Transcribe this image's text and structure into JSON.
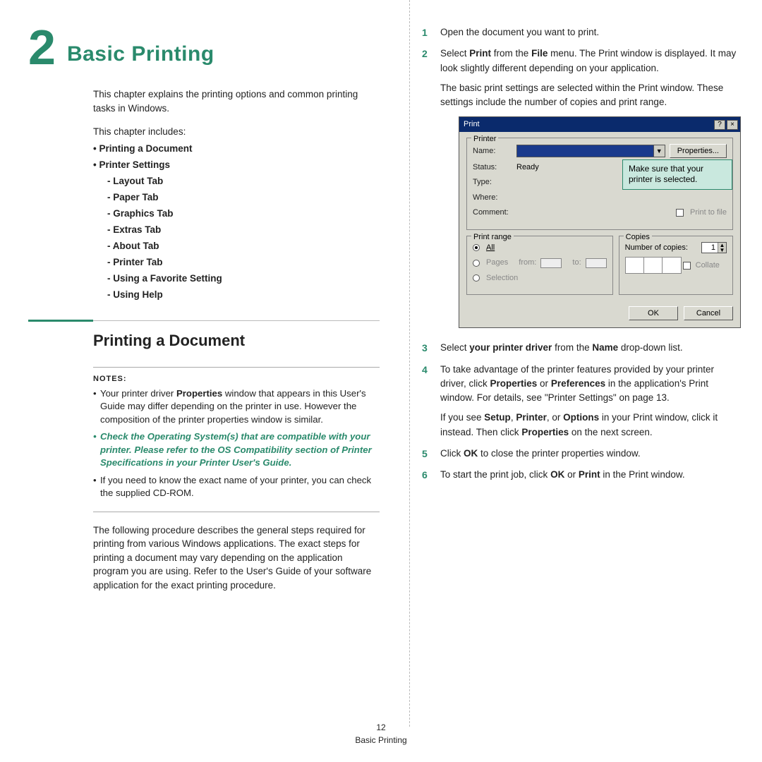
{
  "chapter": {
    "number": "2",
    "title": "Basic Printing"
  },
  "intro": "This chapter explains the printing options and common printing tasks in Windows.",
  "includes_label": "This chapter includes:",
  "toc": {
    "i0": "Printing a Document",
    "i1": "Printer Settings",
    "s0": "Layout Tab",
    "s1": "Paper Tab",
    "s2": "Graphics Tab",
    "s3": "Extras Tab",
    "s4": "About Tab",
    "s5": "Printer Tab",
    "s6": "Using a Favorite Setting",
    "s7": "Using Help"
  },
  "section1_title": "Printing a Document",
  "notes": {
    "label": "NOTES:",
    "n0a": "Your printer driver ",
    "n0b": "Properties",
    "n0c": " window that appears in this User's Guide may differ depending on the printer in use. However the composition of the printer properties window is similar.",
    "n1": "Check the Operating System(s) that are compatible with your printer. Please refer to the OS Compatibility section of Printer Specifications in your Printer User's Guide.",
    "n2": "If you need to know the exact name of your printer, you can check the supplied CD-ROM."
  },
  "after_notes": "The following procedure describes the general steps required for printing from various Windows applications. The exact steps for printing a document may vary depending on the application program you are using. Refer to the User's Guide of your software application for the exact printing procedure.",
  "steps": {
    "s1": "Open the document you want to print.",
    "s2a": "Select ",
    "s2b": "Print",
    "s2c": " from the ",
    "s2d": "File",
    "s2e": " menu. The Print window is displayed. It may look slightly different depending on your application.",
    "s2f": "The basic print settings are selected within the Print window. These settings include the number of copies and print range.",
    "s3a": "Select ",
    "s3b": "your printer driver",
    "s3c": " from the ",
    "s3d": "Name",
    "s3e": " drop-down list.",
    "s4a": "To take advantage of the printer features provided by your printer driver, click ",
    "s4b": "Properties",
    "s4c": " or ",
    "s4d": "Preferences",
    "s4e": " in the application's Print window. For details, see \"Printer Settings\" on page 13.",
    "s4f": "If you see ",
    "s4g": "Setup",
    "s4h": ", ",
    "s4i": "Printer",
    "s4j": ", or ",
    "s4k": "Options",
    "s4l": " in your Print window, click it instead. Then click ",
    "s4m": "Properties",
    "s4n": " on the next screen.",
    "s5a": "Click ",
    "s5b": "OK",
    "s5c": " to close the printer properties window.",
    "s6a": "To start the print job, click ",
    "s6b": "OK",
    "s6c": " or ",
    "s6d": "Print",
    "s6e": " in the Print window."
  },
  "dlg": {
    "title": "Print",
    "help": "?",
    "close": "×",
    "printer_group": "Printer",
    "name_label": "Name:",
    "props_btn": "Properties...",
    "status_label": "Status:",
    "status_val": "Ready",
    "type_label": "Type:",
    "where_label": "Where:",
    "comment_label": "Comment:",
    "print_to_file": "Print to file",
    "range_group": "Print range",
    "all": "All",
    "pages": "Pages",
    "from": "from:",
    "to": "to:",
    "selection": "Selection",
    "copies_group": "Copies",
    "num_copies": "Number of copies:",
    "copies_val": "1",
    "collate": "Collate",
    "ok": "OK",
    "cancel": "Cancel",
    "callout": "Make sure that your printer is selected."
  },
  "footer": {
    "page": "12",
    "label": "Basic Printing"
  }
}
